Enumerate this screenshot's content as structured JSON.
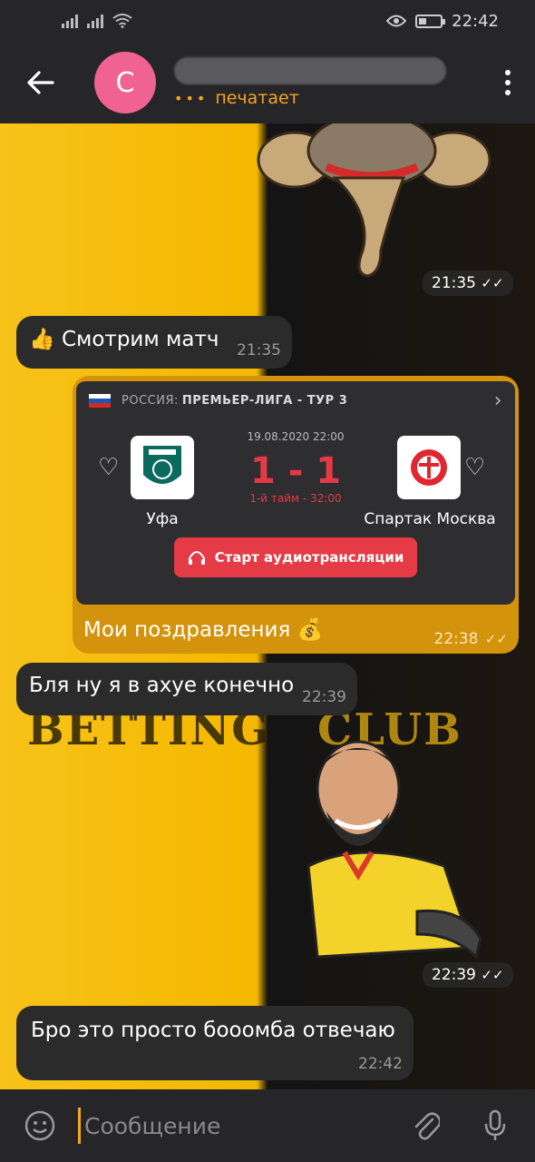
{
  "status": {
    "time": "22:42"
  },
  "header": {
    "avatar_letter": "С",
    "status": "печатает"
  },
  "messages": {
    "m1": {
      "time": "21:35"
    },
    "m2": {
      "text": "👍 Смотрим матч",
      "time": "21:35"
    },
    "m3": {
      "caption": "Мои поздравления 💰",
      "time": "22:38"
    },
    "m4": {
      "text": "Бля ну я в ахуе конечно",
      "time": "22:39"
    },
    "m5": {
      "time": "22:39"
    },
    "m6": {
      "text": "Бро это просто бооомба отвечаю",
      "time": "22:42"
    }
  },
  "match": {
    "league_country": "РОССИЯ:",
    "league_name": "ПРЕМЬЕР-ЛИГА - ТУР 3",
    "datetime": "19.08.2020 22:00",
    "score": "1 - 1",
    "period": "1-й тайм - 32:00",
    "home_team": "Уфа",
    "away_team": "Спартак Москва",
    "audio_button": "Старт аудиотрансляции"
  },
  "background": {
    "word_left": "BETTING",
    "word_right": "CLUB"
  },
  "input": {
    "placeholder": "Сообщение"
  },
  "icons": [
    "back-arrow-icon",
    "more-vert-icon",
    "emoji-icon",
    "attach-icon",
    "mic-icon",
    "heart-icon",
    "headphones-icon",
    "chevron-right-icon",
    "double-check-icon"
  ],
  "colors": {
    "accent": "#f5a623",
    "outgoing": "#d3930c",
    "incoming": "#2b2b2b",
    "avatar": "#f06292",
    "live": "#e53945"
  }
}
